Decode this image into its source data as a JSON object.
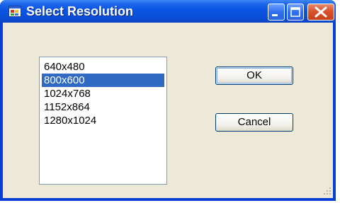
{
  "window": {
    "title": "Select Resolution",
    "title_icon": "app-window-icon",
    "controls": [
      "minimize-icon",
      "maximize-icon",
      "close-icon"
    ]
  },
  "resolution_list": {
    "items": [
      "640x480",
      "800x600",
      "1024x768",
      "1152x864",
      "1280x1024"
    ],
    "selected": "800x600"
  },
  "buttons": {
    "ok_label": "OK",
    "cancel_label": "Cancel"
  },
  "colors": {
    "title_bar": "#0a55e2",
    "selection": "#316ac5",
    "dialog_face": "#ece9d8",
    "close_button": "#d9532c"
  }
}
